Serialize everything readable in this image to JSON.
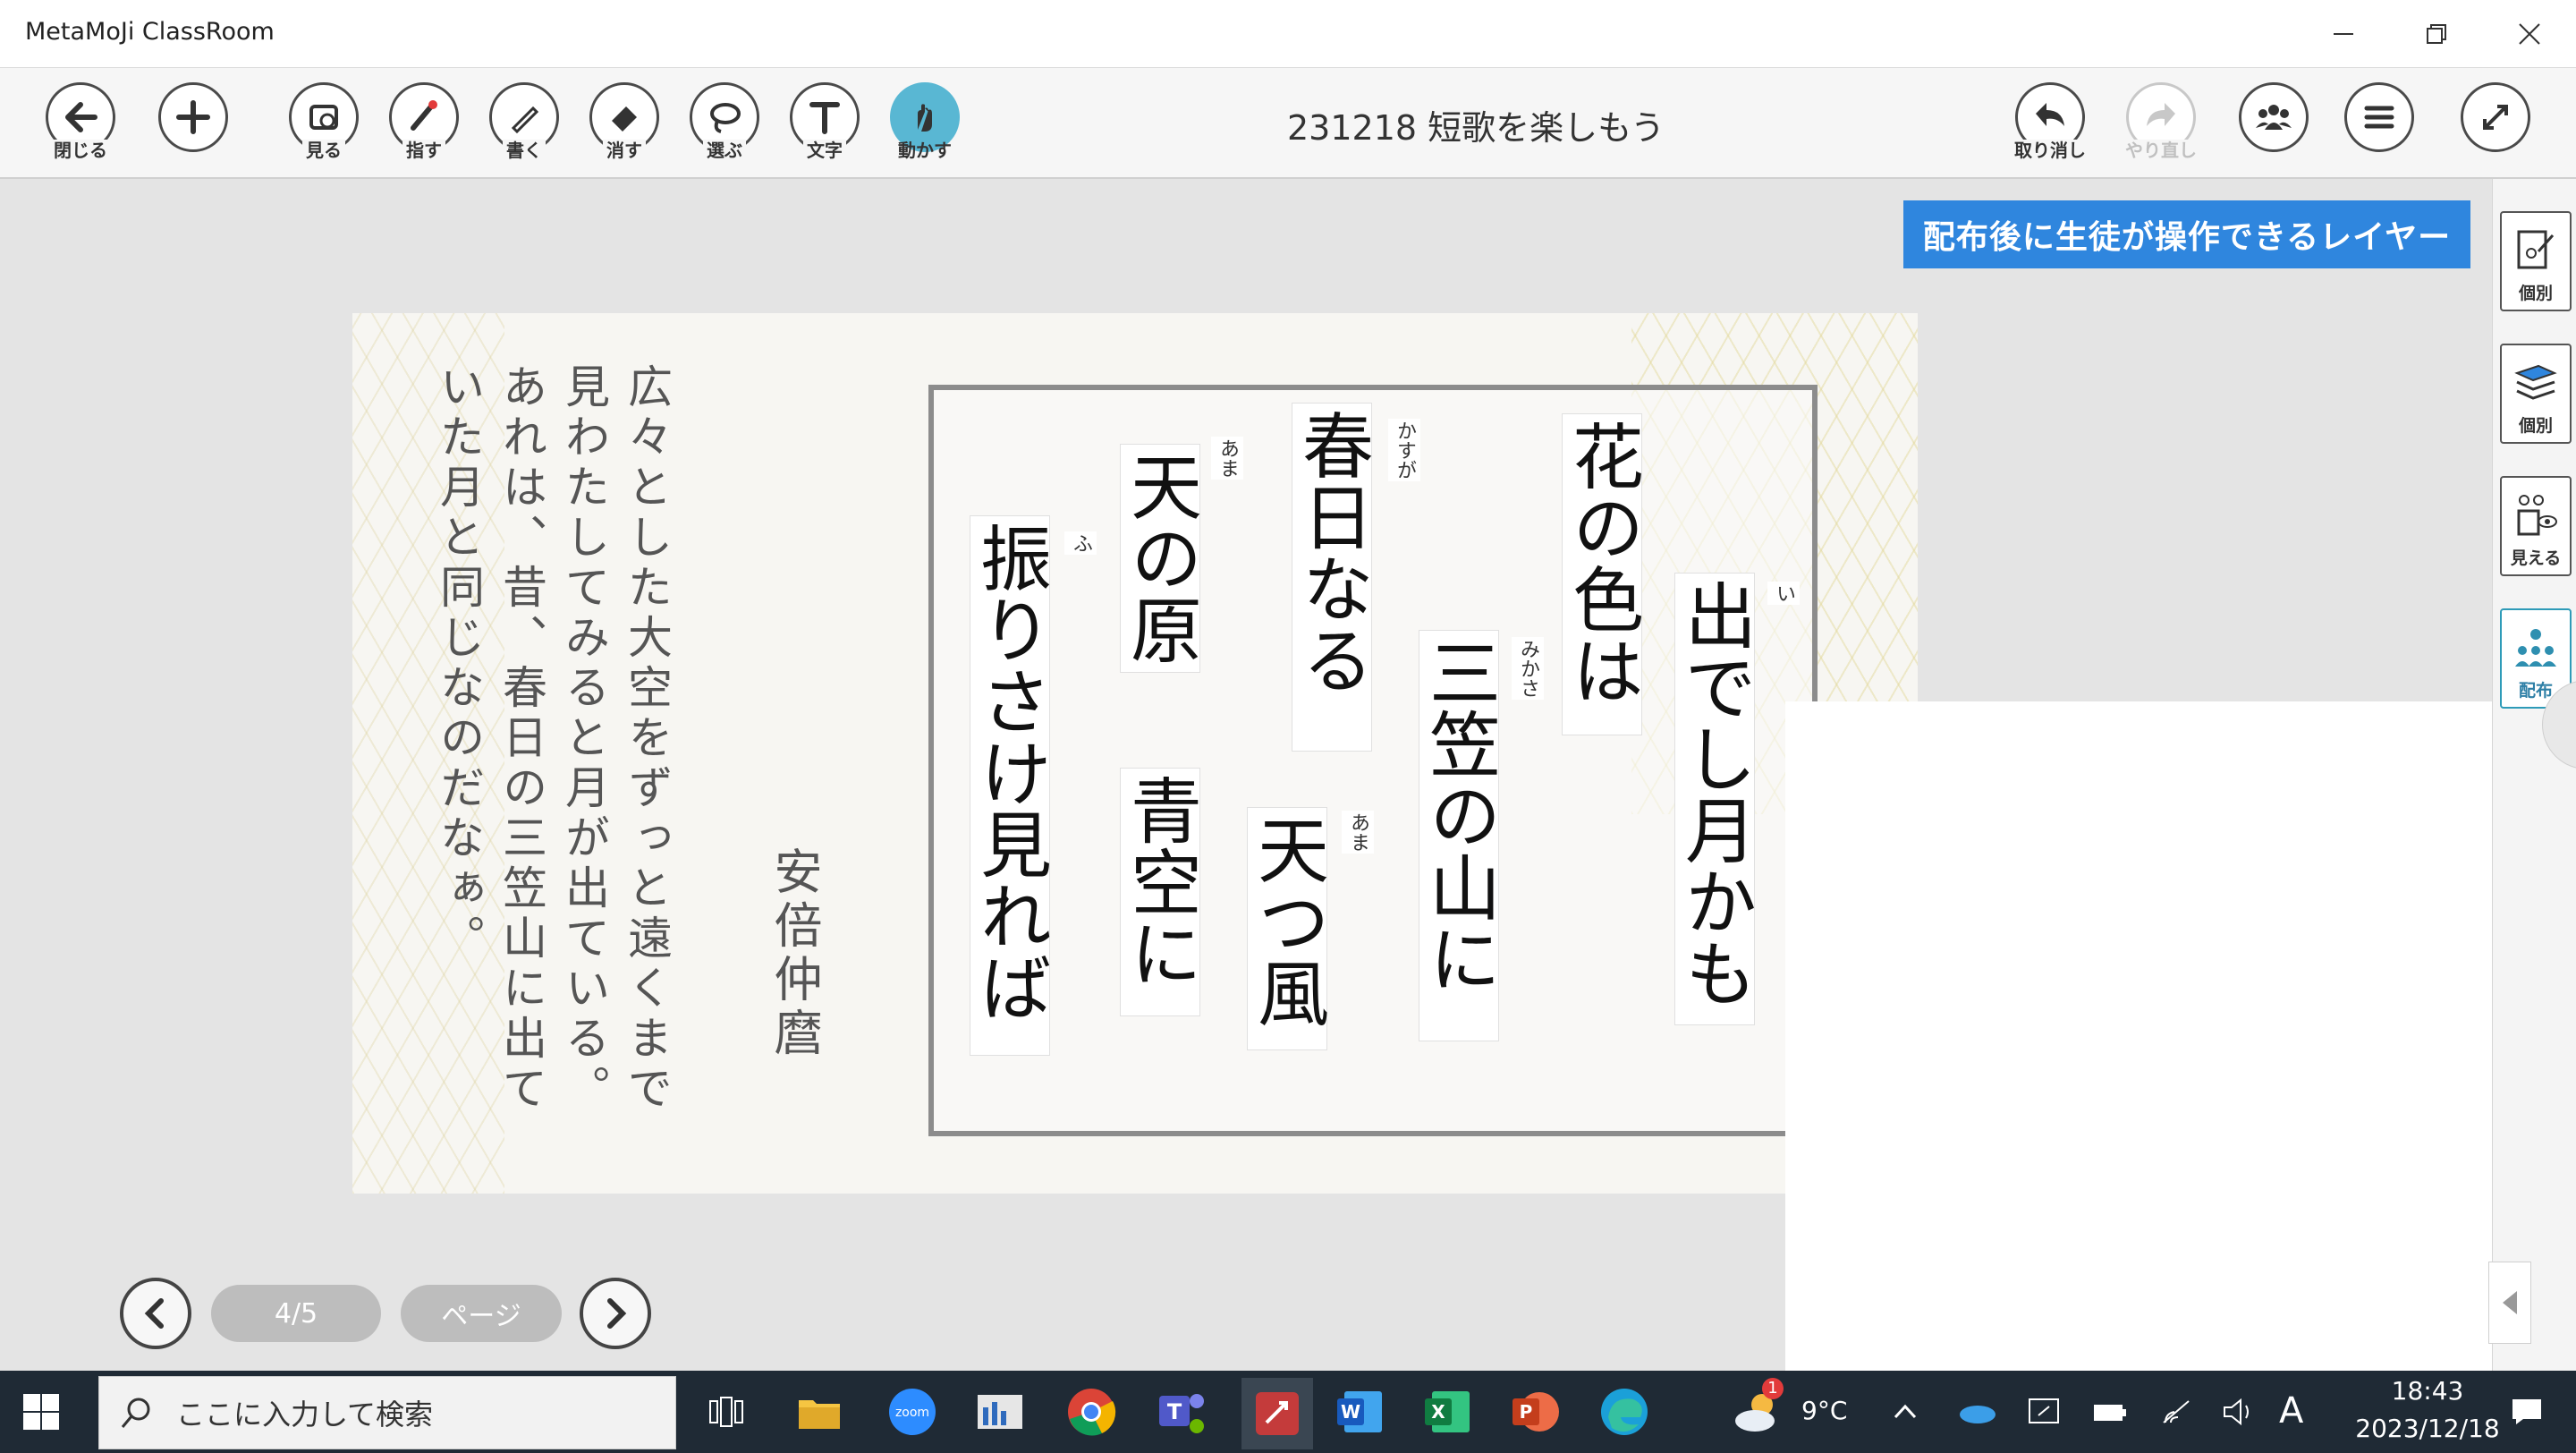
{
  "window": {
    "title": "MetaMoJi ClassRoom"
  },
  "toolbar": {
    "doc_title": "231218 短歌を楽しもう",
    "tools": {
      "close": "閉じる",
      "view": "見る",
      "point": "指す",
      "write": "書く",
      "erase": "消す",
      "select": "選ぶ",
      "text": "文字",
      "move": "動かす",
      "undo": "取り消し",
      "redo": "やり直し"
    }
  },
  "canvas": {
    "layer_banner": "配布後に生徒が操作できるレイヤー"
  },
  "tanka": {
    "line1": "出でし月かも",
    "line2": "三笠の山に",
    "line3": "花の色は",
    "line4": "天つ風",
    "line5": "春日なる",
    "line6": "青空に",
    "line7": "天の原",
    "line8": "振りさけ見れば",
    "ruby": {
      "i": "い",
      "mikasa": "みかさ",
      "kasuga": "かすが",
      "ama1": "あま",
      "ama2": "あま",
      "fu": "ふ"
    },
    "author": "安倍仲麿",
    "explanation": [
      "広々とした大空をずっと遠くまで",
      "見わたしてみると月が出ている。",
      "あれは、昔、春日の三笠山に出て",
      "いた月と同じなのだなぁ。"
    ]
  },
  "sidebar": {
    "individual1": "個別",
    "individual2": "個別",
    "visible": "見える",
    "distribute": "配布"
  },
  "pagenav": {
    "page_indicator": "4/5",
    "page_button": "ページ"
  },
  "taskbar": {
    "search_placeholder": "ここに入力して検索",
    "weather_temp": "9°C",
    "weather_badge": "1",
    "ime": "A",
    "time": "18:43",
    "date": "2023/12/18"
  }
}
